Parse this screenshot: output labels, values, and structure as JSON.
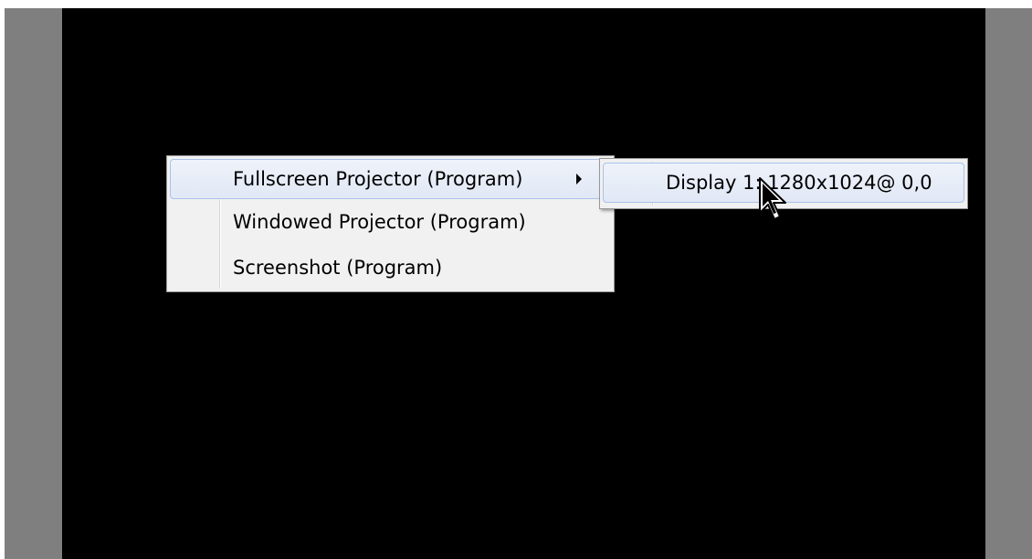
{
  "context_menu": {
    "items": [
      {
        "label": "Fullscreen Projector (Program)",
        "has_submenu": true,
        "highlighted": true
      },
      {
        "label": "Windowed Projector (Program)",
        "has_submenu": false,
        "highlighted": false
      },
      {
        "label": "Screenshot (Program)",
        "has_submenu": false,
        "highlighted": false
      }
    ]
  },
  "submenu": {
    "items": [
      {
        "label": "Display 1: 1280x1024@ 0,0",
        "highlighted": true
      }
    ]
  },
  "icons": {
    "submenu_arrow": "chevron-right-icon",
    "cursor": "mouse-pointer-icon"
  },
  "colors": {
    "preview_background": "#000000",
    "frame_background": "#7f7f7f",
    "menu_background": "#f1f1f1",
    "highlight_border": "#a8c2ea"
  }
}
